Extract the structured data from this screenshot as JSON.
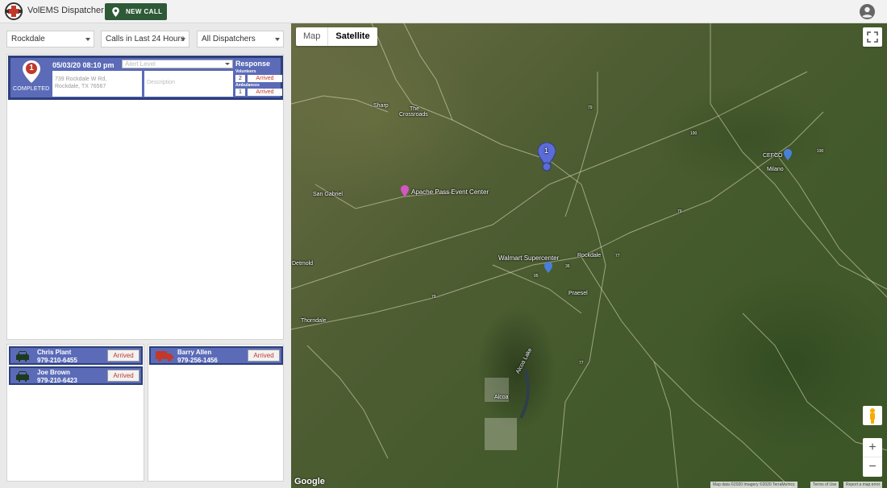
{
  "header": {
    "app_title": "VolEMS Dispatcher",
    "new_call_label": "NEW CALL"
  },
  "filters": {
    "location": "Rockdale",
    "time_range": "Calls in Last 24 Hours",
    "dispatcher": "All Dispatchers"
  },
  "call": {
    "number": "1",
    "status": "COMPLETED",
    "datetime": "05/03/20 08:10 pm",
    "alert_level_placeholder": "Alert Level",
    "address_line1": "739 Rockdale W Rd,",
    "address_line2": "Rockdale, TX 76567",
    "description_placeholder": "Description",
    "response_title": "Response",
    "volunteers_label": "Volunteers",
    "volunteers_count": "2",
    "volunteers_status": "Arrived",
    "ambulances_label": "Ambulances",
    "ambulances_count": "1",
    "ambulances_status": "Arrived"
  },
  "volunteers": [
    {
      "name": "Chris Plant",
      "phone": "979-210-6455",
      "status": "Arrived"
    },
    {
      "name": "Joe Brown",
      "phone": "979-210-6423",
      "status": "Arrived"
    }
  ],
  "ambulances": [
    {
      "name": "Barry Allen",
      "phone": "979-256-1456",
      "status": "Arrived"
    }
  ],
  "map": {
    "type_map": "Map",
    "type_satellite": "Satellite",
    "marker_number": "1",
    "labels": {
      "sharp": "Sharp",
      "the": "The",
      "crossroads": "Crossroads",
      "san_gabriel": "San Gabriel",
      "detmold": "Detmold",
      "thorndale": "Thorndale",
      "rockdale": "Rockdale",
      "praesel": "Praesel",
      "alcoa": "Alcoa",
      "alcoa_lake": "Alcoa Lake",
      "milano": "Milano",
      "cefco": "CEFCO",
      "apache_pass": "Apache Pass Event Center",
      "walmart": "Walmart Supercenter"
    },
    "shields": {
      "s190a": "190",
      "s190b": "190",
      "s79a": "79",
      "s79b": "79",
      "s79c": "79",
      "s77a": "77",
      "s77b": "77",
      "s36": "36",
      "s95": "95"
    },
    "google": "Google",
    "attribution": "Map data ©2020 Imagery ©2020 TerraMetrics",
    "terms": "Terms of Use",
    "report": "Report a map error",
    "zoom_in": "+",
    "zoom_out": "−"
  },
  "colors": {
    "card_bg": "#5b6bb8",
    "card_border": "#2c3f7a",
    "arrived_text": "#c0392b",
    "new_call_bg": "#2e5a37"
  }
}
